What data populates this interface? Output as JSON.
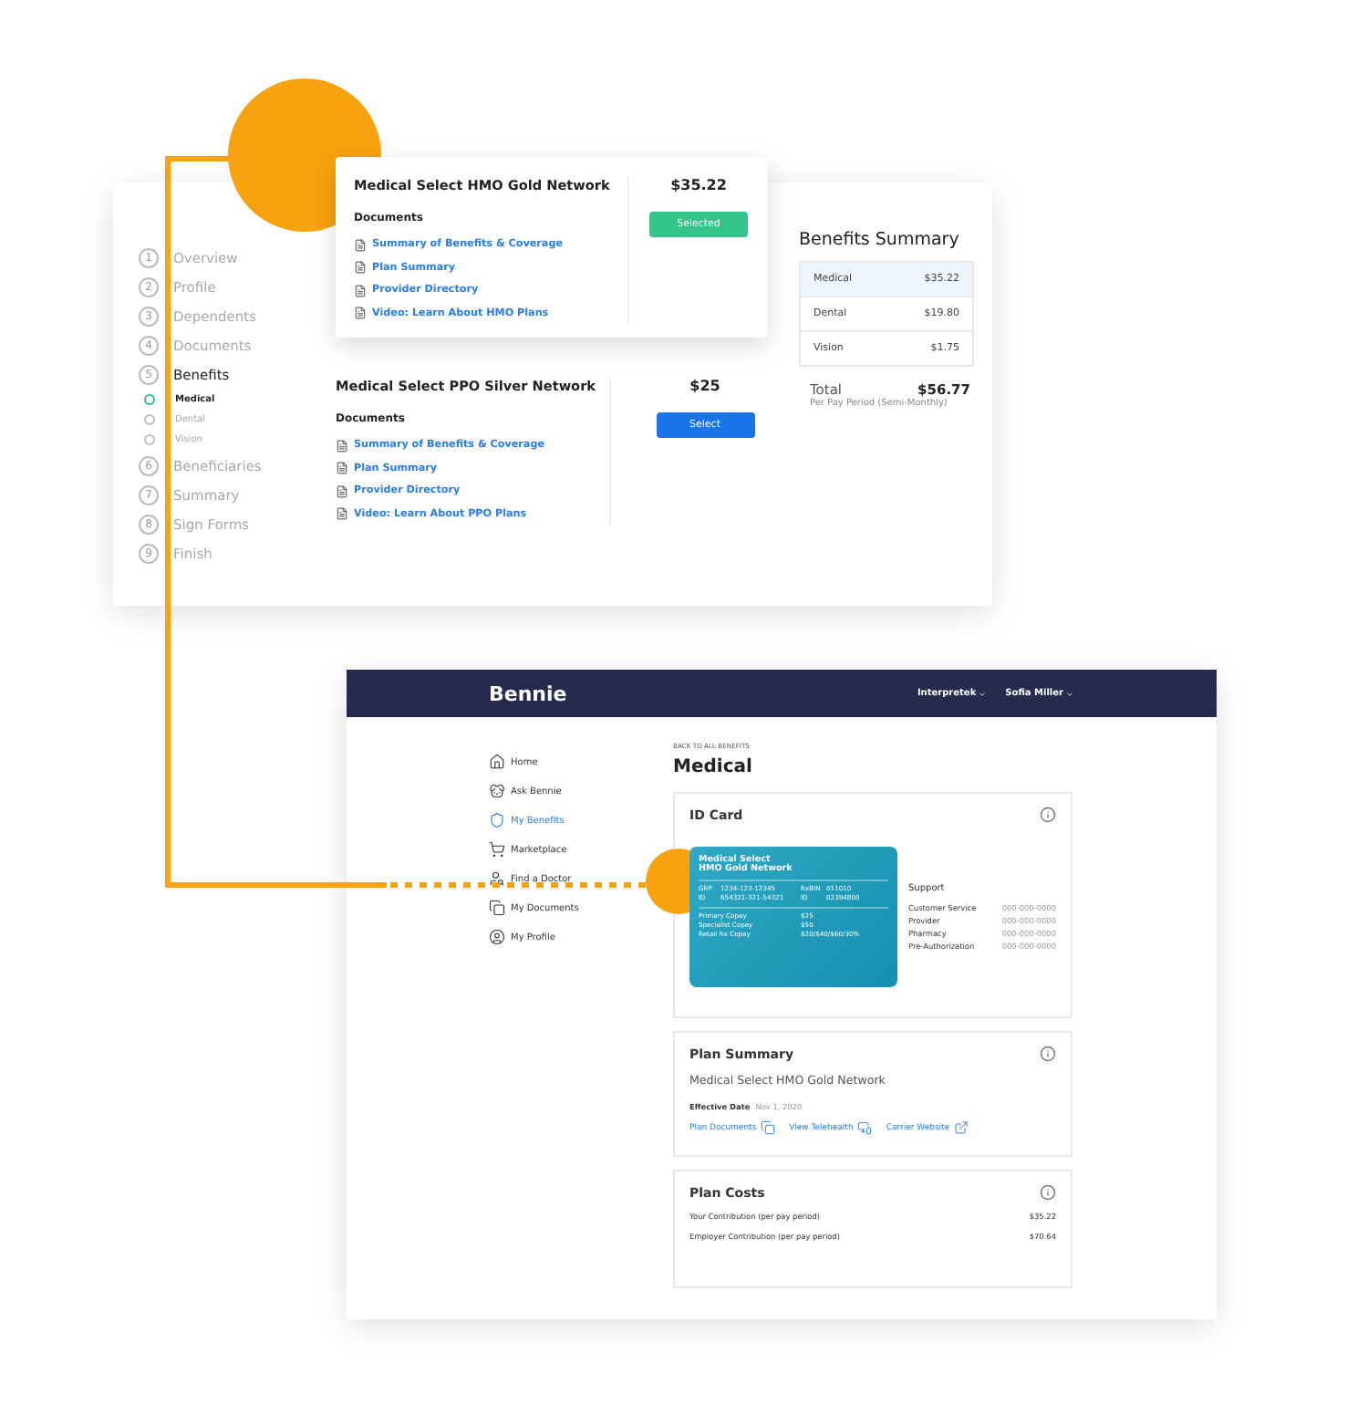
{
  "enrollment": {
    "steps": [
      {
        "number": "1",
        "label": "Overview",
        "selected": false
      },
      {
        "number": "2",
        "label": "Profile",
        "selected": false
      },
      {
        "number": "3",
        "label": "Dependents",
        "selected": false
      },
      {
        "number": "4",
        "label": "Documents",
        "selected": false
      },
      {
        "number": "5",
        "label": "Benefits",
        "selected": true,
        "children": [
          {
            "label": "Medical",
            "selected": true
          },
          {
            "label": "Dental",
            "selected": false
          },
          {
            "label": "Vision",
            "selected": false
          }
        ]
      },
      {
        "number": "6",
        "label": "Beneficiaries",
        "selected": false
      },
      {
        "number": "7",
        "label": "Summary",
        "selected": false
      },
      {
        "number": "8",
        "label": "Sign Forms",
        "selected": false
      },
      {
        "number": "9",
        "label": "Finish",
        "selected": false
      }
    ],
    "plans": [
      {
        "name": "Medical Select HMO Gold Network",
        "price": "$35.22",
        "documents_label": "Documents",
        "documents": [
          "Summary of Benefits & Coverage",
          "Plan Summary",
          "Provider Directory",
          "Video: Learn About HMO Plans"
        ],
        "button": "Selected",
        "selected": true
      },
      {
        "name": "Medical Select PPO Silver Network",
        "price": "$25",
        "documents_label": "Documents",
        "documents": [
          "Summary of Benefits & Coverage",
          "Plan Summary",
          "Provider Directory",
          "Video: Learn About PPO Plans"
        ],
        "button": "Select",
        "selected": false
      }
    ],
    "summary": {
      "title": "Benefits Summary",
      "rows": [
        {
          "label": "Medical",
          "amount": "$35.22",
          "selected": true
        },
        {
          "label": "Dental",
          "amount": "$19.80",
          "selected": false
        },
        {
          "label": "Vision",
          "amount": "$1.75",
          "selected": false
        }
      ],
      "total_label": "Total",
      "total": "$56.77",
      "period": "Per Pay Period (Semi-Monthly)"
    }
  },
  "portal": {
    "logo": "Bennie",
    "menus": [
      "Interpretek",
      "Sofia Miller"
    ],
    "nav": [
      {
        "label": "Home",
        "selected": false
      },
      {
        "label": "Ask Bennie",
        "selected": false
      },
      {
        "label": "My Benefits",
        "selected": true
      },
      {
        "label": "Marketplace",
        "selected": false
      },
      {
        "label": "Find a Doctor",
        "selected": false
      },
      {
        "label": "My Documents",
        "selected": false
      },
      {
        "label": "My Profile",
        "selected": false
      }
    ],
    "back_link": "BACK TO ALL BENEFITS",
    "title": "Medical",
    "id_card": {
      "title": "ID Card",
      "card_title": [
        "Medical Select",
        "HMO Gold Network"
      ],
      "ids": [
        [
          "GRP",
          "1234-123-12345",
          "RxBIN",
          "011010"
        ],
        [
          "ID",
          "654321-321-54321",
          "ID",
          "02394800"
        ]
      ],
      "copays": [
        [
          "Primary Copay",
          "$25"
        ],
        [
          "Specialist Copay",
          "$50"
        ],
        [
          "Retail Rx Copay",
          "$20/$40/$60/30%"
        ]
      ],
      "support_title": "Support",
      "support": [
        [
          "Customer Service",
          "000-000-0000"
        ],
        [
          "Provider",
          "000-000-0000"
        ],
        [
          "Pharmacy",
          "000-000-0000"
        ],
        [
          "Pre-Authorization",
          "000-000-0000"
        ]
      ]
    },
    "plan_summary": {
      "title": "Plan Summary",
      "plan": "Medical Select HMO Gold Network",
      "date_label": "Effective Date",
      "date": "Nov 1, 2020",
      "links": [
        "Plan Documents",
        "View Telehealth",
        "Carrier Website"
      ]
    },
    "plan_costs": {
      "title": "Plan Costs",
      "rows": [
        [
          "Your Contribution (per pay period)",
          "$35.22"
        ],
        [
          "Employer Contribution (per pay period)",
          "$70.64"
        ]
      ]
    }
  }
}
